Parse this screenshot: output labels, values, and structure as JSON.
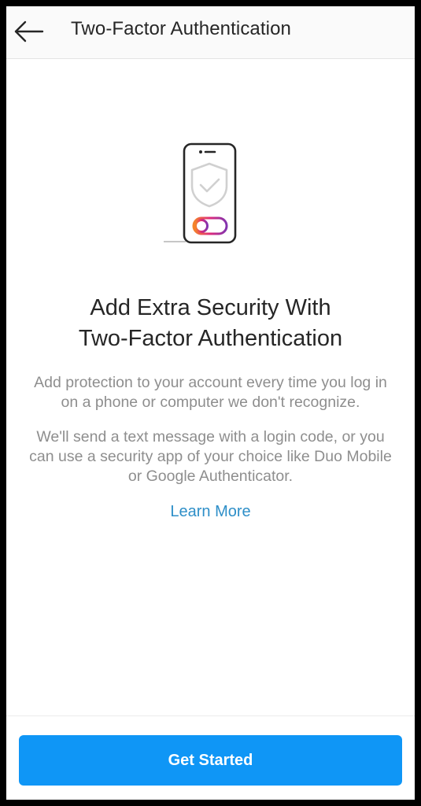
{
  "header": {
    "back_icon": "arrow-left-icon",
    "title": "Two-Factor Authentication"
  },
  "illustration": {
    "icons": [
      "phone-icon",
      "shield-check-icon",
      "toggle-icon"
    ],
    "toggle_gradient": [
      "#f58529",
      "#dd2a7b",
      "#8134af"
    ]
  },
  "main": {
    "headline_line1": "Add Extra Security With",
    "headline_line2": "Two-Factor Authentication",
    "paragraph1": "Add protection to your account every time you log in on a phone or computer we don't recognize.",
    "paragraph2": "We'll send a text message with a login code, or you can use a security app of your choice like Duo Mobile or Google Authenticator.",
    "learn_more": "Learn More"
  },
  "footer": {
    "cta_label": "Get Started"
  },
  "colors": {
    "accent": "#0f96f6",
    "link": "#2e8fc8",
    "text_primary": "#262626",
    "text_secondary": "#8e8e8e"
  }
}
